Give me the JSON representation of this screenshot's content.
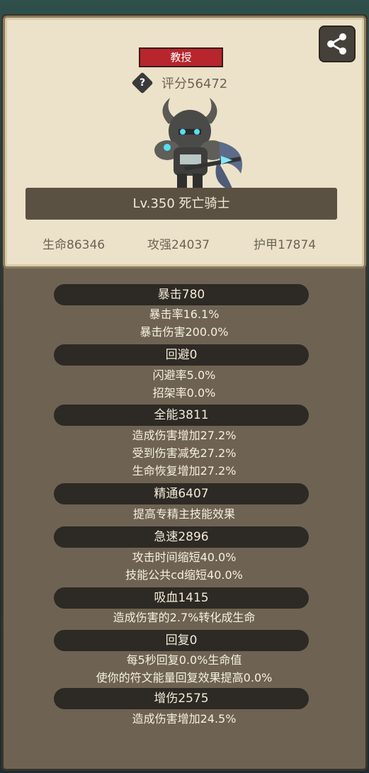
{
  "hero_card": {
    "title_badge": "教授",
    "help_symbol": "?",
    "score": "评分56472",
    "name": "Lv.350 死亡骑士",
    "stats": [
      "生命86346",
      "攻强24037",
      "护甲17874"
    ]
  },
  "sections": [
    {
      "title": "暴击780",
      "lines": [
        "暴击率16.1%",
        "暴击伤害200.0%"
      ]
    },
    {
      "title": "回避0",
      "lines": [
        "闪避率5.0%",
        "招架率0.0%"
      ]
    },
    {
      "title": "全能3811",
      "lines": [
        "造成伤害增加27.2%",
        "受到伤害减免27.2%",
        "生命恢复增加27.2%"
      ]
    },
    {
      "title": "精通6407",
      "lines": [
        "提高专精主技能效果"
      ]
    },
    {
      "title": "急速2896",
      "lines": [
        "攻击时间缩短40.0%",
        "技能公共cd缩短40.0%"
      ]
    },
    {
      "title": "吸血1415",
      "lines": [
        "造成伤害的2.7%转化成生命"
      ]
    },
    {
      "title": "回复0",
      "lines": [
        "每5秒回复0.0%生命值",
        "使你的符文能量回复效果提高0.0%"
      ]
    },
    {
      "title": "增伤2575",
      "lines": [
        "造成伤害增加24.5%"
      ]
    }
  ]
}
